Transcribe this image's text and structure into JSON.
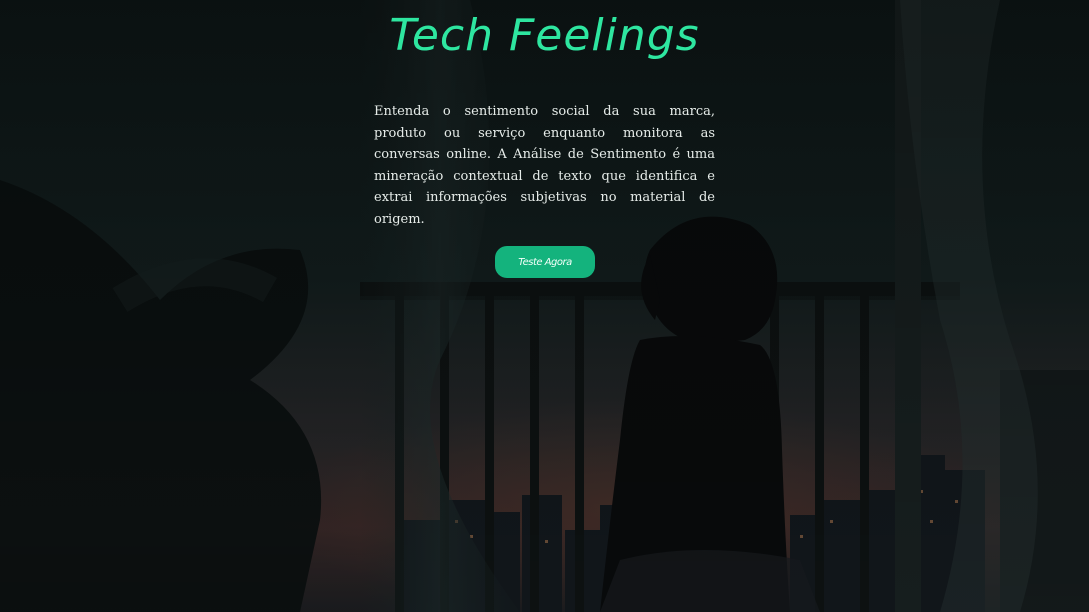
{
  "hero": {
    "title": "Tech Feelings",
    "description": "Entenda o sentimento social da sua marca, produto ou serviço enquanto monitora as conversas online. A Análise de Sentimento é uma mineração contextual de texto que identifica e extrai informações subjetivas no material de origem.",
    "cta_label": "Teste Agora"
  },
  "colors": {
    "accent": "#2ee6a0",
    "button": "#14b37d",
    "background": "#0d1515",
    "text": "#e6ece9"
  },
  "background_image": "anime-girl-on-balcony-night-city"
}
